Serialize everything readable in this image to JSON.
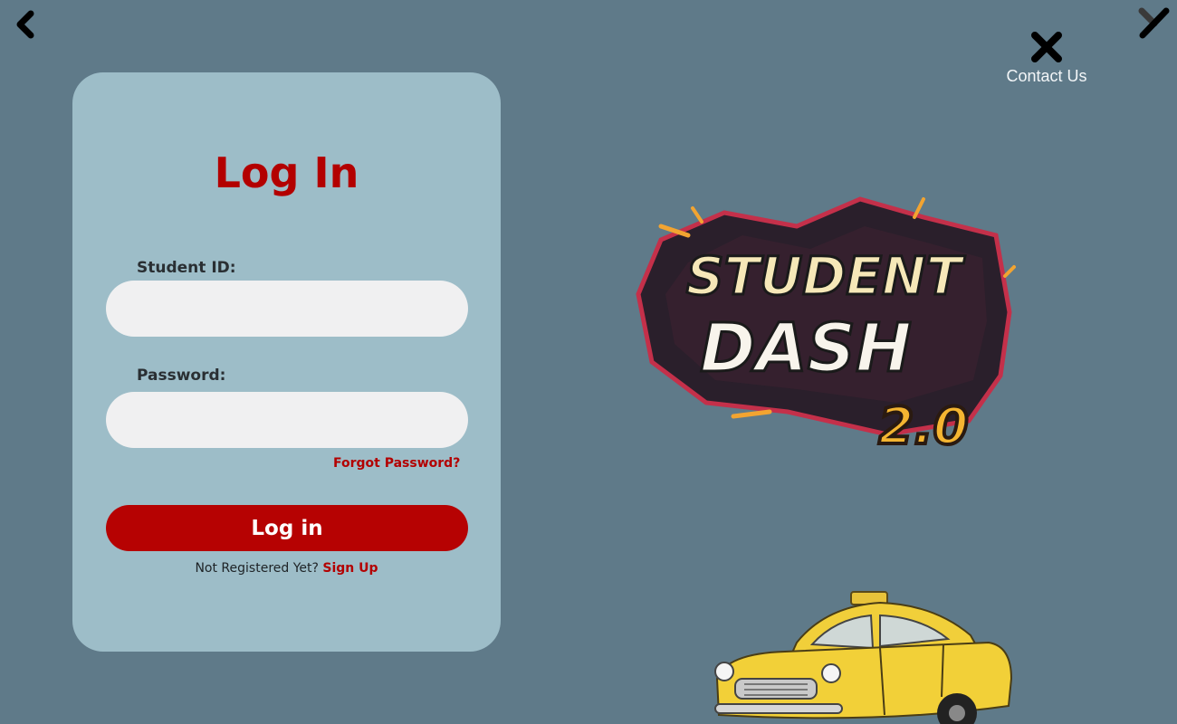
{
  "topbar": {
    "back_icon": "chevron-left-icon",
    "edit_icon": "pencil-icon",
    "contact": {
      "icon": "tools-icon",
      "label": "Contact Us"
    }
  },
  "login": {
    "title": "Log In",
    "student_id_label": "Student ID:",
    "student_id_value": "",
    "password_label": "Password:",
    "password_value": "",
    "forgot_label": "Forgot Password?",
    "submit_label": "Log in",
    "not_registered_text": "Not Registered Yet?",
    "signup_label": "Sign Up"
  },
  "logo": {
    "line1": "STUDENT",
    "line2": "DASH",
    "version": "2.0"
  },
  "colors": {
    "background": "#5f7a89",
    "card": "#9dbdc8",
    "accent": "#b30000",
    "input": "#f0f0f1"
  }
}
